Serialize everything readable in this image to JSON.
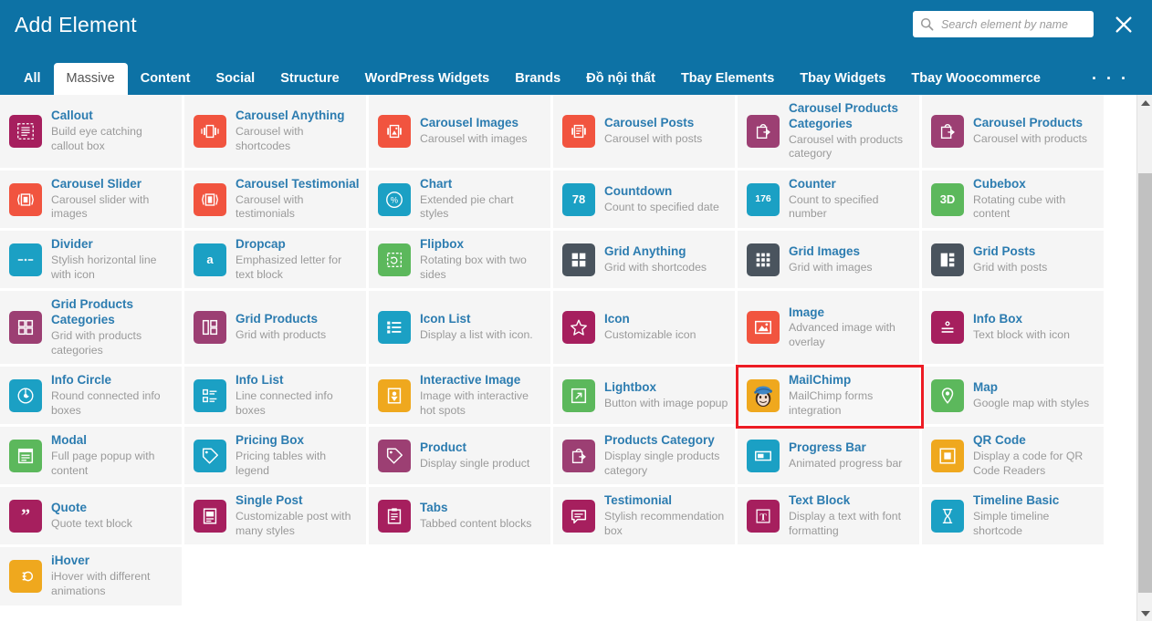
{
  "header": {
    "title": "Add Element",
    "search": {
      "placeholder": "Search element by name",
      "value": "",
      "icon": "search-icon"
    },
    "close_icon": "close-icon"
  },
  "tabs": {
    "items": [
      {
        "label": "All",
        "active": false
      },
      {
        "label": "Massive",
        "active": true
      },
      {
        "label": "Content",
        "active": false
      },
      {
        "label": "Social",
        "active": false
      },
      {
        "label": "Structure",
        "active": false
      },
      {
        "label": "WordPress Widgets",
        "active": false
      },
      {
        "label": "Brands",
        "active": false
      },
      {
        "label": "Đồ nội thất",
        "active": false
      },
      {
        "label": "Tbay Elements",
        "active": false
      },
      {
        "label": "Tbay Widgets",
        "active": false
      },
      {
        "label": "Tbay Woocommerce",
        "active": false
      }
    ],
    "more_label": ". . ."
  },
  "scrollbar": {
    "up_icon": "triangle-up-icon",
    "down_icon": "triangle-down-icon"
  },
  "colors": {
    "header_blue": "#0d72a5",
    "title_blue": "#2c7cb0",
    "selection_red": "#ed1c24",
    "purple": "#9c3f73",
    "magenta": "#a61f5e",
    "orange_red": "#f1543f",
    "cyan": "#1ba0c4",
    "green": "#5cb85c",
    "dark_slate": "#4a545e",
    "amber": "#efa81e"
  },
  "elements": [
    {
      "title": "Callout",
      "desc": "Build eye catching callout box",
      "icon": "callout-icon",
      "color": "#a61f5e"
    },
    {
      "title": "Carousel Anything",
      "desc": "Carousel with shortcodes",
      "icon": "carousel-anything-icon",
      "color": "#f1543f"
    },
    {
      "title": "Carousel Images",
      "desc": "Carousel with images",
      "icon": "carousel-images-icon",
      "color": "#f1543f"
    },
    {
      "title": "Carousel Posts",
      "desc": "Carousel with posts",
      "icon": "carousel-posts-icon",
      "color": "#f1543f"
    },
    {
      "title": "Carousel Products Categories",
      "desc": "Carousel with products category",
      "icon": "products-categories-icon",
      "color": "#9c3f73"
    },
    {
      "title": "Carousel Products",
      "desc": "Carousel with products",
      "icon": "products-icon",
      "color": "#9c3f73"
    },
    {
      "title": "Carousel Slider",
      "desc": "Carousel slider with images",
      "icon": "carousel-slider-icon",
      "color": "#f1543f"
    },
    {
      "title": "Carousel Testimonial",
      "desc": "Carousel with testimonials",
      "icon": "carousel-testimonial-icon",
      "color": "#f1543f"
    },
    {
      "title": "Chart",
      "desc": "Extended pie chart styles",
      "icon": "pie-chart-icon",
      "color": "#1ba0c4"
    },
    {
      "title": "Countdown",
      "desc": "Count to specified date",
      "icon": "countdown-icon",
      "color": "#1ba0c4",
      "glyph": "78"
    },
    {
      "title": "Counter",
      "desc": "Count to specified number",
      "icon": "counter-icon",
      "color": "#1ba0c4",
      "glyph": "176"
    },
    {
      "title": "Cubebox",
      "desc": "Rotating cube with content",
      "icon": "cubebox-icon",
      "color": "#5cb85c",
      "glyph": "3D"
    },
    {
      "title": "Divider",
      "desc": "Stylish horizontal line with icon",
      "icon": "divider-icon",
      "color": "#1ba0c4"
    },
    {
      "title": "Dropcap",
      "desc": "Emphasized letter for text block",
      "icon": "dropcap-icon",
      "color": "#1ba0c4",
      "glyph": "a"
    },
    {
      "title": "Flipbox",
      "desc": "Rotating box with two sides",
      "icon": "flipbox-icon",
      "color": "#5cb85c"
    },
    {
      "title": "Grid Anything",
      "desc": "Grid with shortcodes",
      "icon": "grid-anything-icon",
      "color": "#4a545e"
    },
    {
      "title": "Grid Images",
      "desc": "Grid with images",
      "icon": "grid-images-icon",
      "color": "#4a545e"
    },
    {
      "title": "Grid Posts",
      "desc": "Grid with posts",
      "icon": "grid-posts-icon",
      "color": "#4a545e"
    },
    {
      "title": "Grid Products Categories",
      "desc": "Grid with products categories",
      "icon": "grid-products-categories-icon",
      "color": "#9c3f73"
    },
    {
      "title": "Grid Products",
      "desc": "Grid with products",
      "icon": "grid-products-icon",
      "color": "#9c3f73"
    },
    {
      "title": "Icon List",
      "desc": "Display a list with icon.",
      "icon": "icon-list-icon",
      "color": "#1ba0c4"
    },
    {
      "title": "Icon",
      "desc": "Customizable icon",
      "icon": "star-icon",
      "color": "#a61f5e"
    },
    {
      "title": "Image",
      "desc": "Advanced image with overlay",
      "icon": "image-icon",
      "color": "#f1543f"
    },
    {
      "title": "Info Box",
      "desc": "Text block with icon",
      "icon": "info-box-icon",
      "color": "#a61f5e"
    },
    {
      "title": "Info Circle",
      "desc": "Round connected info boxes",
      "icon": "info-circle-icon",
      "color": "#1ba0c4"
    },
    {
      "title": "Info List",
      "desc": "Line connected info boxes",
      "icon": "info-list-icon",
      "color": "#1ba0c4"
    },
    {
      "title": "Interactive Image",
      "desc": "Image with interactive hot spots",
      "icon": "interactive-image-icon",
      "color": "#efa81e"
    },
    {
      "title": "Lightbox",
      "desc": "Button with image popup",
      "icon": "lightbox-icon",
      "color": "#5cb85c"
    },
    {
      "title": "MailChimp",
      "desc": "MailChimp forms integration",
      "icon": "mailchimp-icon",
      "color": "#efa81e",
      "selected": true
    },
    {
      "title": "Map",
      "desc": "Google map with styles",
      "icon": "map-pin-icon",
      "color": "#5cb85c"
    },
    {
      "title": "Modal",
      "desc": "Full page popup with content",
      "icon": "modal-icon",
      "color": "#5cb85c"
    },
    {
      "title": "Pricing Box",
      "desc": "Pricing tables with legend",
      "icon": "pricing-box-icon",
      "color": "#1ba0c4"
    },
    {
      "title": "Product",
      "desc": "Display single product",
      "icon": "product-tag-icon",
      "color": "#9c3f73"
    },
    {
      "title": "Products Category",
      "desc": "Display single products category",
      "icon": "products-categories-icon",
      "color": "#9c3f73"
    },
    {
      "title": "Progress Bar",
      "desc": "Animated progress bar",
      "icon": "progress-bar-icon",
      "color": "#1ba0c4"
    },
    {
      "title": "QR Code",
      "desc": "Display a code for QR Code Readers",
      "icon": "qr-code-icon",
      "color": "#efa81e"
    },
    {
      "title": "Quote",
      "desc": "Quote text block",
      "icon": "quote-icon",
      "color": "#a61f5e"
    },
    {
      "title": "Single Post",
      "desc": "Customizable post with many styles",
      "icon": "single-post-icon",
      "color": "#a61f5e"
    },
    {
      "title": "Tabs",
      "desc": "Tabbed content blocks",
      "icon": "tabs-icon",
      "color": "#a61f5e"
    },
    {
      "title": "Testimonial",
      "desc": "Stylish recommendation box",
      "icon": "testimonial-icon",
      "color": "#a61f5e"
    },
    {
      "title": "Text Block",
      "desc": "Display a text with font formatting",
      "icon": "text-block-icon",
      "color": "#a61f5e"
    },
    {
      "title": "Timeline Basic",
      "desc": "Simple timeline shortcode",
      "icon": "timeline-icon",
      "color": "#1ba0c4"
    },
    {
      "title": "iHover",
      "desc": "iHover with different animations",
      "icon": "ihover-icon",
      "color": "#efa81e"
    }
  ]
}
